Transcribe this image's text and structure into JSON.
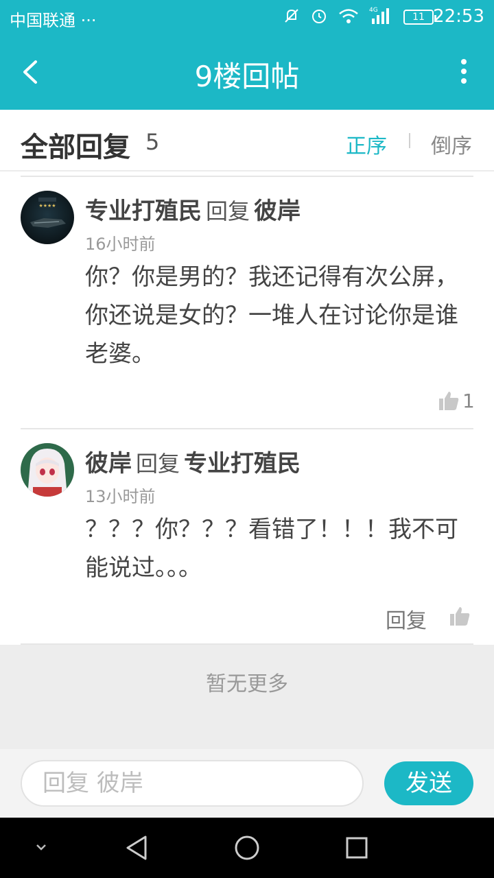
{
  "status_bar": {
    "carrier": "中国联通 ···",
    "signal_label": "4G",
    "battery": "11",
    "time": "22:53"
  },
  "app_bar": {
    "title": "9楼回帖"
  },
  "reply_header": {
    "label": "全部回复",
    "count": "5",
    "sort_asc": "正序",
    "sort_desc": "倒序"
  },
  "replies": [
    {
      "author": "专业打殖民",
      "verb": "回复",
      "target": "彼岸",
      "time": "16小时前",
      "content": "你？你是男的？我还记得有次公屏，你还说是女的？一堆人在讨论你是谁老婆。",
      "like_count": "1"
    },
    {
      "author": "彼岸",
      "verb": "回复",
      "target": "专业打殖民",
      "time": "13小时前",
      "content": "？？？你？？？看错了！！！我不可能说过。。。",
      "reply_label": "回复"
    }
  ],
  "no_more": "暂无更多",
  "input": {
    "placeholder": "回复 彼岸",
    "send_label": "发送"
  },
  "colors": {
    "accent": "#1cb8c6"
  }
}
